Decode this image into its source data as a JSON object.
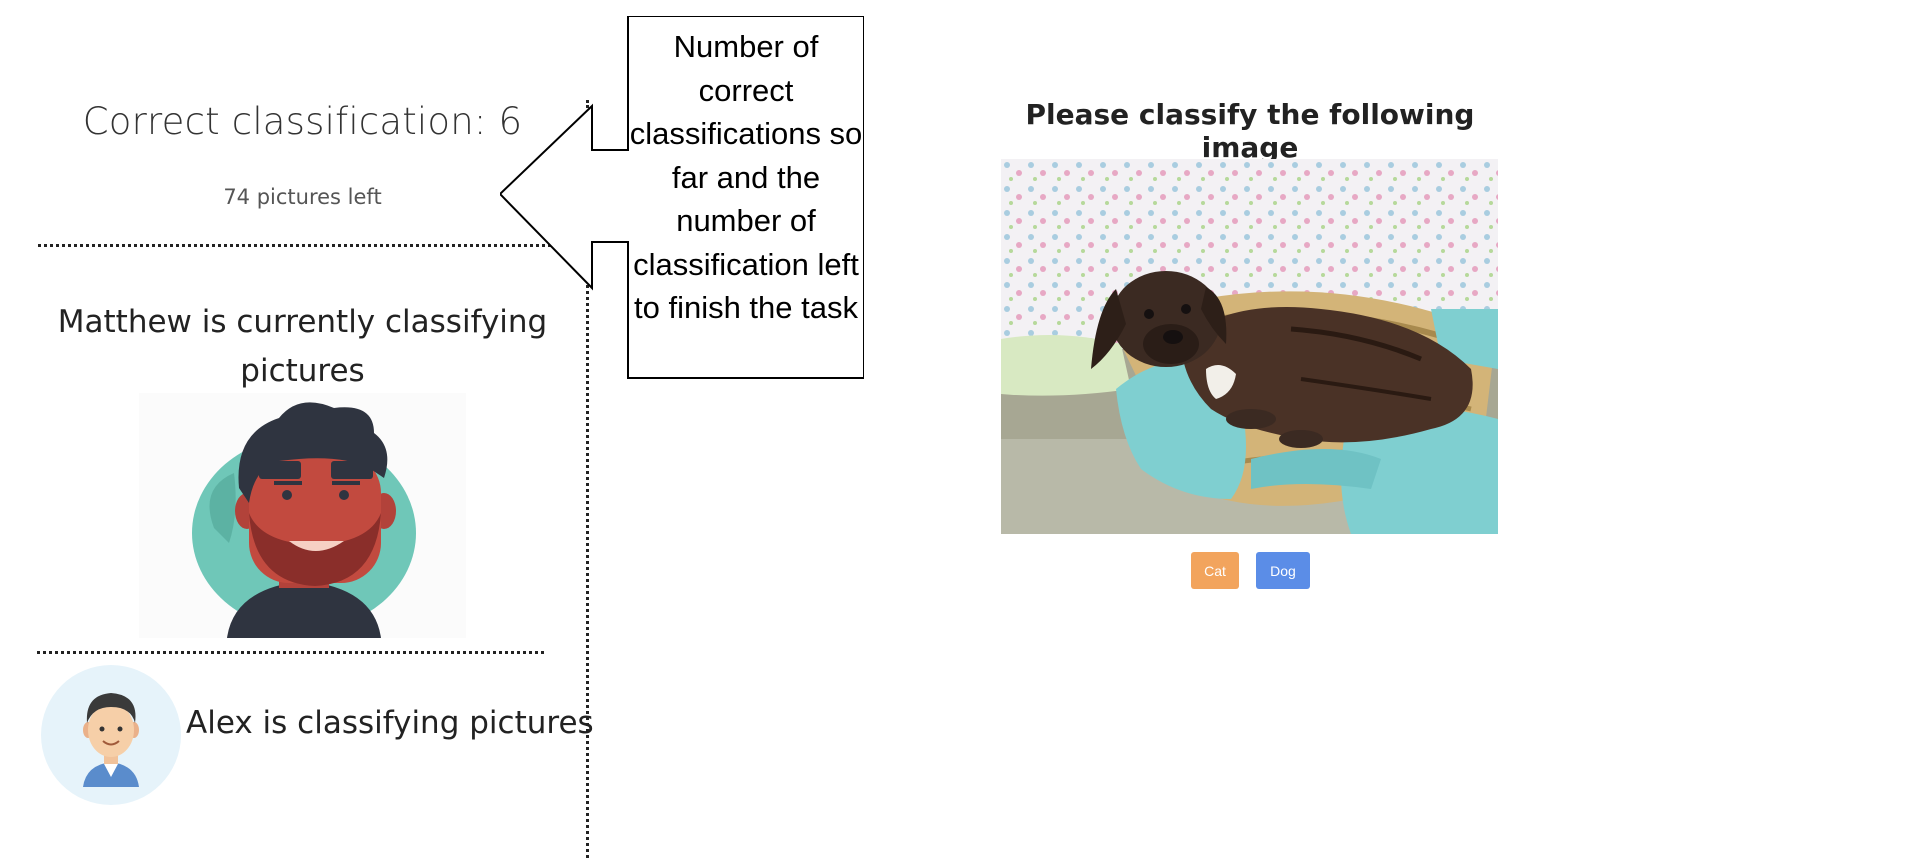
{
  "left_panel": {
    "score_label": "Correct classification: 6",
    "pictures_left": "74 pictures left",
    "matthew_status": "Matthew is currently classifying pictures",
    "alex_status": "Alex is classifying pictures"
  },
  "callout": {
    "text": "Number of correct classifications so far and the number of classification left to finish the task"
  },
  "main": {
    "title": "Please classify the following image",
    "buttons": {
      "cat_label": "Cat",
      "dog_label": "Dog"
    }
  },
  "colors": {
    "cat_button": "#f2a45d",
    "dog_button": "#5b8de7",
    "avatar_teal": "#6fc7b8",
    "avatar_skin": "#c24a3f",
    "blanket": "#7fcfd0"
  },
  "icons": {
    "matthew_avatar": "bearded-man-avatar-icon",
    "alex_avatar": "man-avatar-icon",
    "photo": "puppy-in-basket-photo"
  }
}
